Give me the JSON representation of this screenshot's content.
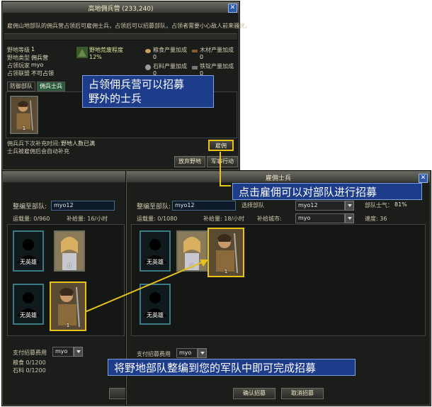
{
  "camp_window": {
    "title": "高地佣兵营 (233,240)",
    "description": "雇佣山地部队的佣兵营占领后可雇佣士兵，占领后可以招募部队，占领者需要小心敌人前来骚扰。",
    "stats_left": [
      {
        "label": "野地等级",
        "value": "1"
      },
      {
        "label": "野地类型",
        "value": "佣兵营"
      },
      {
        "label": "占领玩家",
        "value": "myo"
      },
      {
        "label": "占领联盟",
        "value": "不可占领"
      }
    ],
    "wild_label": "野地荒废程度",
    "wild_value": "12%",
    "production": [
      {
        "label": "粮食产量加成",
        "value": "0"
      },
      {
        "label": "木材产量加成",
        "value": "0"
      },
      {
        "label": "石料产量加成",
        "value": "0"
      },
      {
        "label": "铁锭产量加成",
        "value": "0"
      }
    ],
    "tabs": [
      "防御部队",
      "佣兵士兵"
    ],
    "card_count": "1",
    "next_replenish_label": "佣兵兵下次补充时间:",
    "next_replenish_value": "野地人数已满",
    "auto_note": "士兵被雇佣后会自动补充",
    "hire_button": "雇佣",
    "abandon_button": "放弃野地",
    "military_button": "军事行动"
  },
  "left_window": {
    "reorg_label": "整编至部队:",
    "troop_name": "myo12",
    "capacity_label": "运载量: 0/960",
    "supply_label": "补给量: 16/小时",
    "cards": [
      {
        "type": "empty",
        "label": "无英雄"
      },
      {
        "type": "hero",
        "count": "8"
      },
      {
        "type": "empty",
        "label": "无英雄"
      },
      {
        "type": "hero",
        "count": "1"
      }
    ],
    "cost_label": "支付招募费用",
    "cost_payer": "myo",
    "food": "粮食 0/1200",
    "stone": "石料 0/1200"
  },
  "right_window": {
    "title": "雇佣士兵",
    "reorg_label": "整编至部队:",
    "troop_name": "myo12",
    "select_label": "选择部队",
    "select_value": "myo12",
    "morale_label": "部队士气：",
    "morale_value": "81%",
    "capacity_label": "运载量: 0/1080",
    "supply_label": "补给量: 18/小时",
    "city_label": "补给城市:",
    "city_value": "myo",
    "speed_label": "速度: 36",
    "cards": [
      {
        "type": "empty",
        "label": "无英雄"
      },
      {
        "type": "hero",
        "count": "8"
      },
      {
        "type": "hero",
        "count": "1"
      },
      {
        "type": "empty",
        "label": "无英雄"
      }
    ],
    "cost_label": "支付招募费用",
    "cost_payer": "myo",
    "confirm_button": "确认招募",
    "cancel_button": "取消招募"
  },
  "annotations": {
    "a1_line1": "占领佣兵营可以招募",
    "a1_line2": "野外的士兵",
    "a2": "点击雇佣可以对部队进行招募",
    "a3": "将野地部队整编到您的军队中即可完成招募"
  },
  "colors": {
    "highlight": "#e7c21b",
    "annotation_bg": "#1d3d8a",
    "card_border": "#3a7a84"
  }
}
